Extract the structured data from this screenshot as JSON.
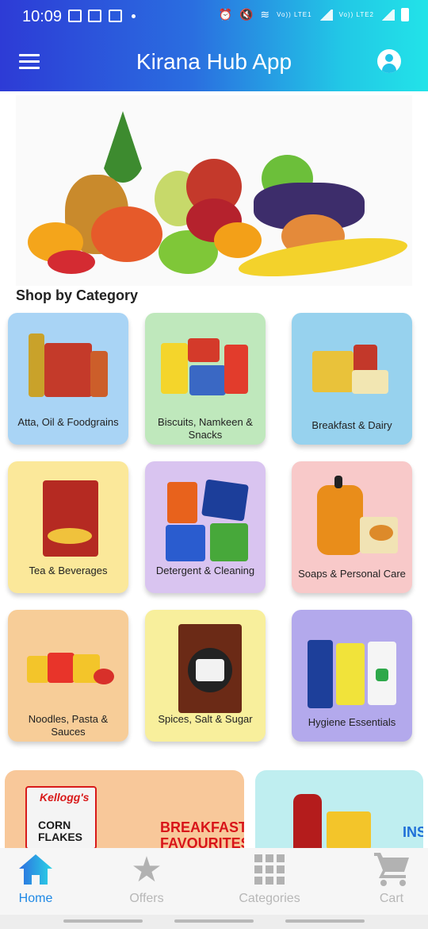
{
  "status_bar": {
    "time": "10:09",
    "carrier1": "Vo)) LTE1",
    "carrier2": "Vo)) LTE2"
  },
  "header": {
    "title": "Kirana Hub App"
  },
  "section": {
    "title": "Shop by Category"
  },
  "categories": [
    {
      "label": "Atta, Oil & Foodgrains",
      "bg": "#a9d4f5"
    },
    {
      "label": "Biscuits, Namkeen & Snacks",
      "bg": "#bfe8bc"
    },
    {
      "label": "Breakfast & Dairy",
      "bg": "#97d2ee"
    },
    {
      "label": "Tea & Beverages",
      "bg": "#fbe89a"
    },
    {
      "label": "Detergent & Cleaning",
      "bg": "#d9c4f0"
    },
    {
      "label": "Soaps & Personal Care",
      "bg": "#f8c9c9"
    },
    {
      "label": "Noodles, Pasta & Sauces",
      "bg": "#f7cd98"
    },
    {
      "label": "Spices, Salt & Sugar",
      "bg": "#f8ef9c"
    },
    {
      "label": "Hygiene Essentials",
      "bg": "#b3a9ec"
    }
  ],
  "promos": {
    "p1": {
      "line1": "BREAKFAST",
      "line2": "FAVOURITES",
      "brand": "Kellogg's",
      "product": "CORN FLAKES"
    },
    "p2": {
      "text": "INS"
    }
  },
  "bottom_nav": [
    {
      "label": "Home",
      "icon": "home-icon",
      "active": true
    },
    {
      "label": "Offers",
      "icon": "star-icon",
      "active": false
    },
    {
      "label": "Categories",
      "icon": "grid-icon",
      "active": false
    },
    {
      "label": "Cart",
      "icon": "cart-icon",
      "active": false
    }
  ],
  "colors": {
    "accent": "#1e88e5",
    "header_start": "#2d3bd6",
    "header_end": "#22e3e8"
  }
}
